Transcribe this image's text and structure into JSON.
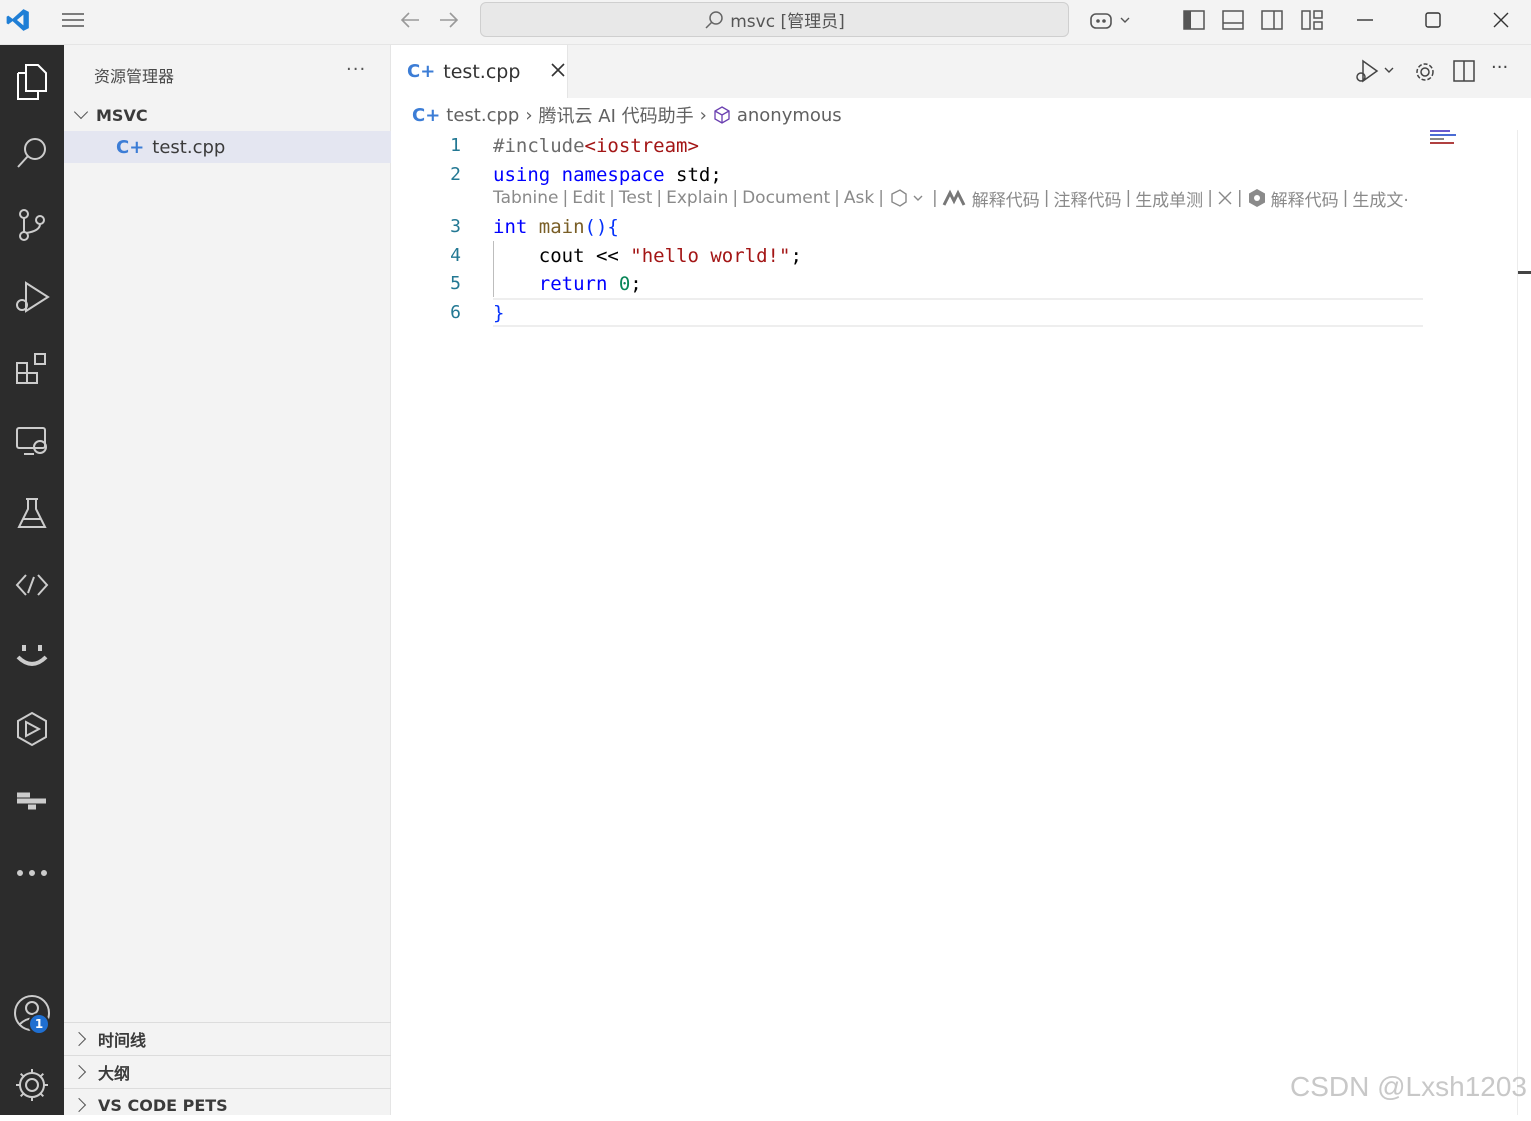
{
  "titlebar": {
    "search_text": "msvc [管理员]",
    "icons": [
      "vscode-logo-icon",
      "menu-icon",
      "back-arrow-icon",
      "forward-arrow-icon",
      "copilot-icon",
      "toggle-sidebar-icon",
      "toggle-panel-icon",
      "toggle-secondary-sidebar-icon",
      "customize-layout-icon",
      "minimize-icon",
      "maximize-icon",
      "close-icon"
    ]
  },
  "activitybar": {
    "items": [
      "explorer-icon",
      "search-icon",
      "source-control-icon",
      "run-debug-icon",
      "extensions-icon",
      "remote-explorer-icon",
      "testing-icon",
      "live-share-icon",
      "tabnine-icon",
      "container-icon",
      "docker-icon",
      "more-icon"
    ],
    "accounts_badge": "1"
  },
  "sidebar": {
    "title": "资源管理器",
    "more": "···",
    "folder": "MSVC",
    "file": "test.cpp",
    "sections": [
      "时间线",
      "大纲",
      "VS CODE PETS"
    ]
  },
  "editor": {
    "tab_label": "test.cpp",
    "tab_icon": "C+",
    "breadcrumb": {
      "file": "test.cpp",
      "scope": "腾讯云 AI 代码助手",
      "symbol": "anonymous"
    },
    "lines": [
      {
        "n": "1"
      },
      {
        "n": "2"
      },
      {
        "n": "3"
      },
      {
        "n": "4"
      },
      {
        "n": "5"
      },
      {
        "n": "6"
      }
    ],
    "code": {
      "l1_directive": "#include",
      "l1_header": "<iostream>",
      "l2_using": "using",
      "l2_namespace": "namespace",
      "l2_rest": " std;",
      "l3_int": "int",
      "l3_main": " main",
      "l3_rest": "(){",
      "l4_cout": "    cout << ",
      "l4_str": "\"hello world!\"",
      "l4_semi": ";",
      "l5_return": "    return",
      "l5_space": " ",
      "l5_num": "0",
      "l5_semi": ";",
      "l6_brace": "}"
    },
    "codelens": {
      "tabnine": "Tabnine",
      "edit": "Edit",
      "test": "Test",
      "explain": "Explain",
      "document": "Document",
      "ask": "Ask",
      "explain_cn": "解释代码",
      "comment_cn": "注释代码",
      "gen_test_cn": "生成单测",
      "explain_cn2": "解释代码",
      "gen_doc_cn": "生成文·"
    }
  },
  "watermark": "CSDN @Lxsh1203"
}
